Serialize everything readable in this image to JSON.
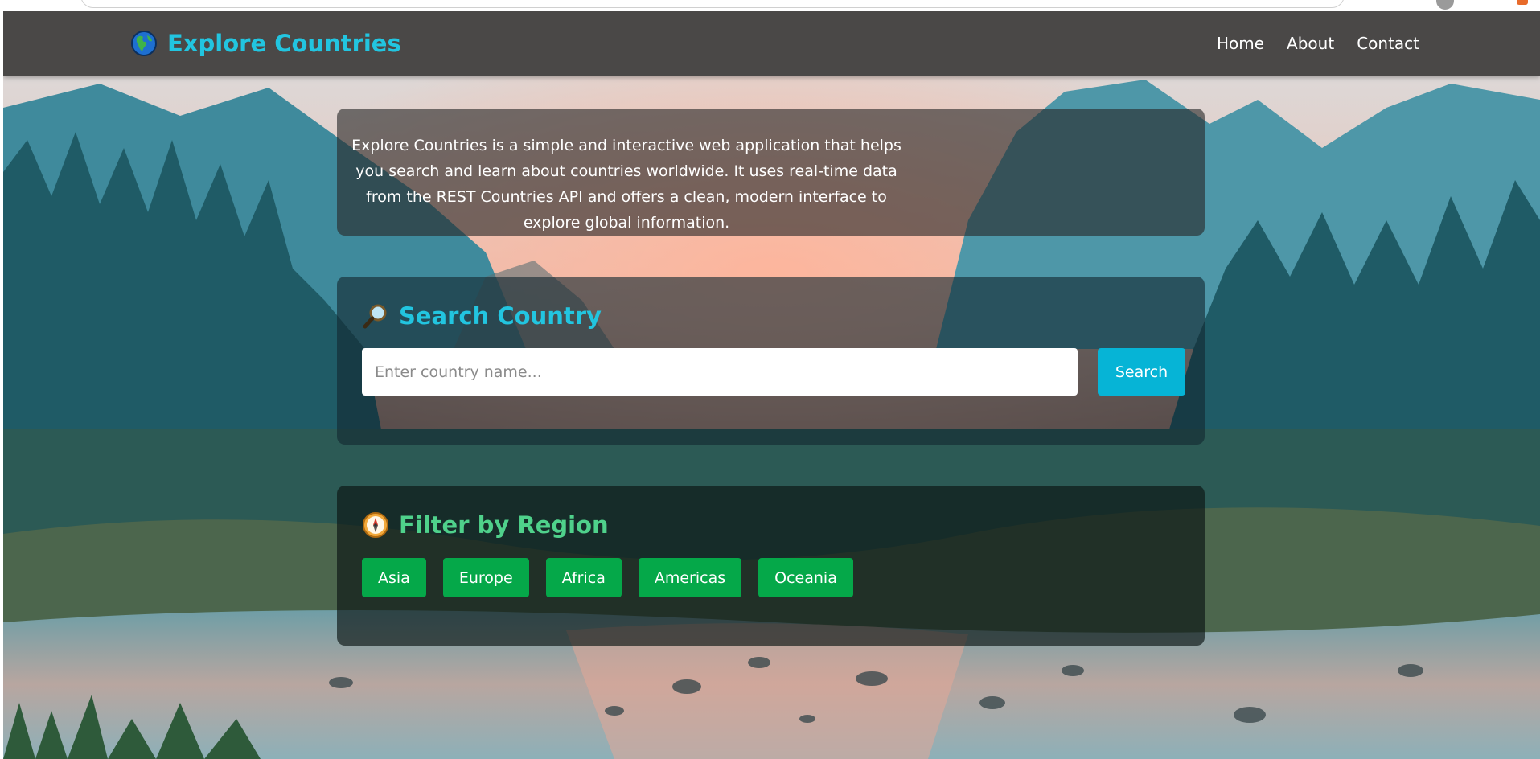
{
  "header": {
    "brand_title": "Explore Countries",
    "brand_icon": "globe-icon",
    "nav": [
      {
        "label": "Home"
      },
      {
        "label": "About"
      },
      {
        "label": "Contact"
      }
    ]
  },
  "about": {
    "text": "Explore Countries is a simple and interactive web application that helps you search and learn about countries worldwide. It uses real-time data from the REST Countries API and offers a clean, modern interface to explore global information."
  },
  "search": {
    "icon": "magnifier-icon",
    "title": "Search Country",
    "placeholder": "Enter country name...",
    "value": "",
    "button_label": "Search"
  },
  "filter": {
    "icon": "compass-icon",
    "title": "Filter by Region",
    "regions": [
      "Asia",
      "Europe",
      "Africa",
      "Americas",
      "Oceania"
    ]
  },
  "colors": {
    "header_bg": "#4a4847",
    "accent_cyan": "#22c5e0",
    "search_button": "#06b4d6",
    "accent_green": "#4fd18b",
    "region_button": "#05a849"
  }
}
